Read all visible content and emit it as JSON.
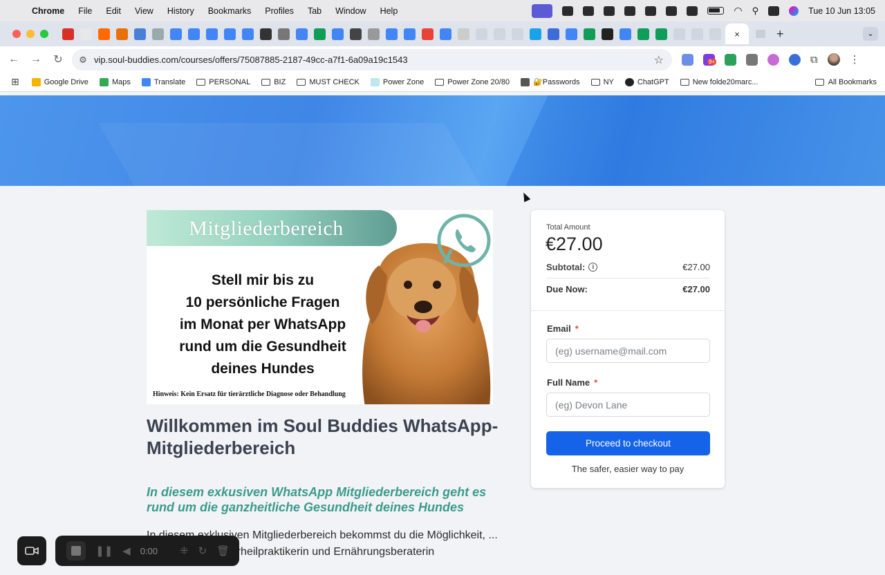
{
  "menubar": {
    "app": "Chrome",
    "menus": [
      "File",
      "Edit",
      "View",
      "History",
      "Bookmarks",
      "Profiles",
      "Tab",
      "Window",
      "Help"
    ],
    "clock": "Tue 10 Jun  13:05"
  },
  "browser": {
    "url": "vip.soul-buddies.com/courses/offers/75087885-2187-49cc-a7f1-6a09a19c1543",
    "active_tab_close": "×",
    "new_tab": "+",
    "bookmarks": [
      {
        "label": "Google Drive",
        "icon": "drive-icon"
      },
      {
        "label": "Maps",
        "icon": "maps-pin-icon"
      },
      {
        "label": "Translate",
        "icon": "translate-icon"
      },
      {
        "label": "PERSONAL",
        "icon": "folder-icon"
      },
      {
        "label": "BIZ",
        "icon": "folder-icon"
      },
      {
        "label": "MUST CHECK",
        "icon": "folder-icon"
      },
      {
        "label": "Power Zone",
        "icon": "page-icon"
      },
      {
        "label": "Power Zone 20/80",
        "icon": "folder-icon"
      },
      {
        "label": "🔐Passwords",
        "icon": "key-icon"
      },
      {
        "label": "NY",
        "icon": "folder-icon"
      },
      {
        "label": "ChatGPT",
        "icon": "chatgpt-icon"
      },
      {
        "label": "New folde20marc...",
        "icon": "folder-icon"
      }
    ],
    "all_bookmarks": "All Bookmarks",
    "extension_badge": "9+"
  },
  "product": {
    "image_banner": "Mitgliederbereich",
    "image_headline": [
      "Stell mir bis zu",
      "10 persönliche Fragen",
      "im Monat per WhatsApp",
      "rund um die Gesundheit",
      "deines Hundes"
    ],
    "image_note": "Hinweis: Kein Ersatz für tierärztliche Diagnose oder Behandlung",
    "title": "Willkommen im Soul Buddies WhatsApp-Mitgliederbereich",
    "subheading": "In diesem exkusiven WhatsApp Mitgliederbereich geht es rund um die ganzheitliche Gesundheit deines Hundes",
    "body": "In diesem exklusiven Mitgliederbereich bekommst du die Möglichkeit, ... die Zertifizierte  Tierheilpraktikerin und Ernährungsberaterin"
  },
  "checkout": {
    "total_label": "Total Amount",
    "total_amount": "€27.00",
    "subtotal_label": "Subtotal:",
    "subtotal_value": "€27.00",
    "due_label": "Due Now:",
    "due_value": "€27.00",
    "email_label": "Email",
    "email_placeholder": "(eg) username@mail.com",
    "name_label": "Full Name",
    "name_placeholder": "(eg) Devon Lane",
    "required_marker": "*",
    "button": "Proceed to checkout",
    "tagline": "The safer, easier way to pay"
  },
  "recorder": {
    "time": "0:00"
  },
  "colors": {
    "accent": "#1463e8",
    "hero": "#3f86e6",
    "subheading": "#3b9a8d"
  }
}
